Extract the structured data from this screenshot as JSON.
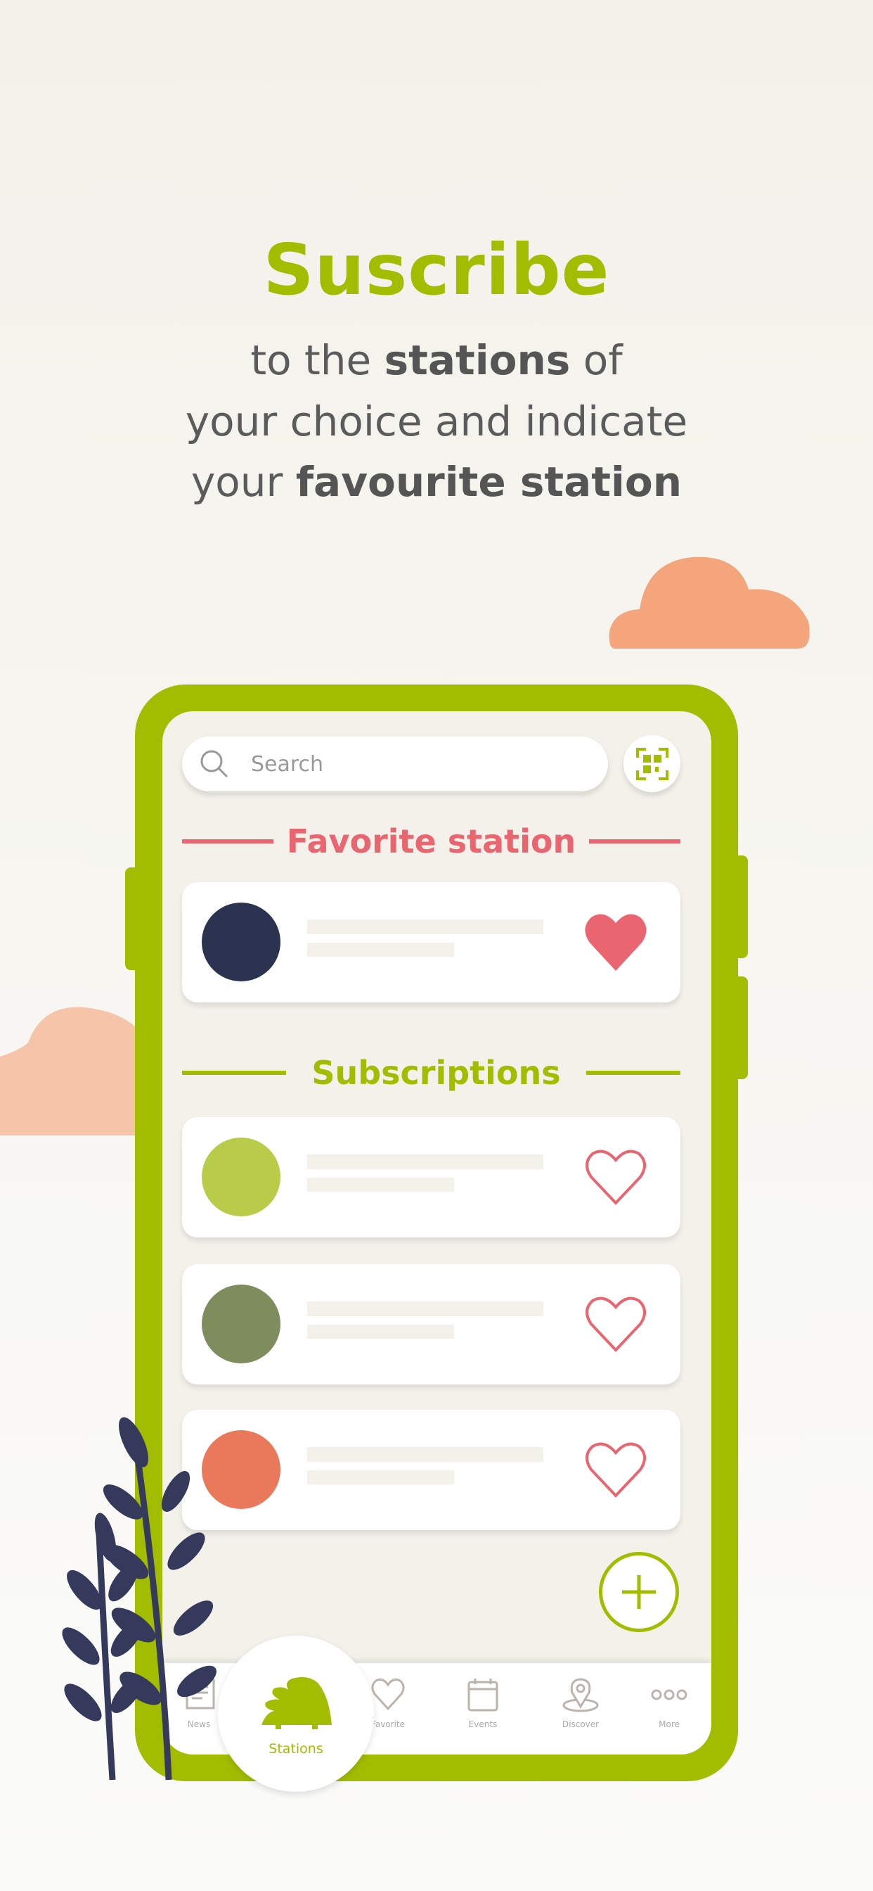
{
  "hero": {
    "title": "Suscribe",
    "line1_a": "to the ",
    "line1_b": "stations",
    "line1_c": " of",
    "line2": "your choice and indicate",
    "line3_a": "your ",
    "line3_b": "favourite station"
  },
  "colors": {
    "accent": "#a2bd00",
    "favorite": "#e9656f",
    "navy": "#2b3350",
    "cloud": "#f4a57c"
  },
  "search": {
    "placeholder": "Search",
    "icon": "search-icon",
    "qr_icon": "qr-scan-icon"
  },
  "favorite_section": {
    "title": "Favorite station",
    "cards": [
      {
        "color": "#2b3350",
        "favorited": true
      }
    ]
  },
  "subscriptions_section": {
    "title": "Subscriptions",
    "cards": [
      {
        "color": "#b8cc4a",
        "favorited": false
      },
      {
        "color": "#7f8d5e",
        "favorited": false
      },
      {
        "color": "#ea795c",
        "favorited": false
      }
    ]
  },
  "fab": {
    "icon": "plus-icon"
  },
  "nav": {
    "items": [
      {
        "label": "News",
        "icon": "news-icon"
      },
      {
        "label": "Stations",
        "icon": "hedgehog-icon",
        "active": true
      },
      {
        "label": "Favorite",
        "icon": "heart-icon"
      },
      {
        "label": "Events",
        "icon": "calendar-icon"
      },
      {
        "label": "Discover",
        "icon": "location-pin-icon"
      },
      {
        "label": "More",
        "icon": "more-dots-icon"
      }
    ]
  }
}
